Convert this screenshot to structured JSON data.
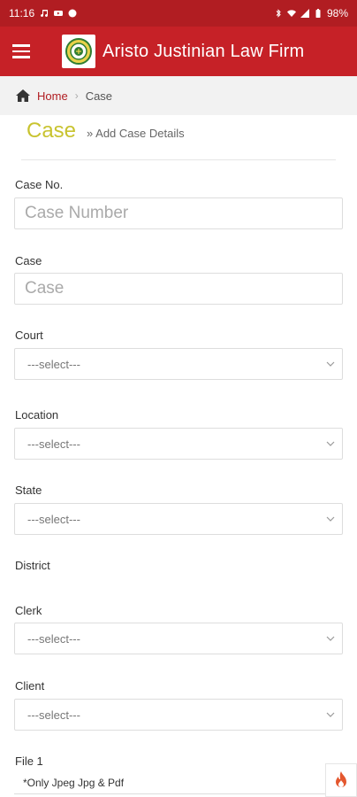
{
  "status_bar": {
    "time": "11:16",
    "battery": "98%"
  },
  "app_bar": {
    "title": "Aristo Justinian Law Firm"
  },
  "breadcrumb": {
    "home": "Home",
    "current": "Case"
  },
  "page": {
    "title": "Case",
    "subtitle": "» Add Case Details"
  },
  "form": {
    "case_no": {
      "label": "Case No.",
      "placeholder": "Case Number",
      "value": ""
    },
    "case": {
      "label": "Case",
      "placeholder": "Case",
      "value": ""
    },
    "court": {
      "label": "Court",
      "selected": "---select---"
    },
    "location": {
      "label": "Location",
      "selected": "---select---"
    },
    "state": {
      "label": "State",
      "selected": "---select---"
    },
    "district": {
      "label": "District"
    },
    "clerk": {
      "label": "Clerk",
      "selected": "---select---"
    },
    "client": {
      "label": "Client",
      "selected": "---select---"
    },
    "file1": {
      "label": "File 1",
      "note": "*Only Jpeg Jpg & Pdf"
    }
  },
  "colors": {
    "primary": "#c62127",
    "status": "#b11d22",
    "accent_title": "#c8c32f"
  },
  "icons": {
    "menu": "menu-icon",
    "home": "home-icon",
    "chevron": "chevron-down-icon",
    "fab": "flame-icon"
  }
}
